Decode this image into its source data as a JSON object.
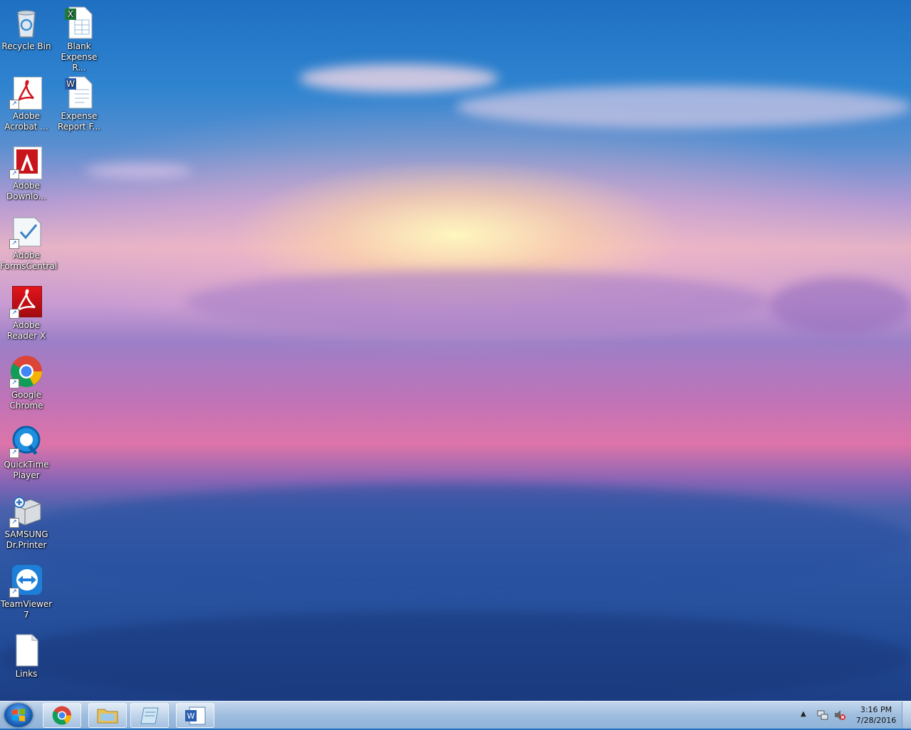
{
  "desktop": {
    "icons": [
      {
        "label": "Recycle Bin",
        "icon": "recycle-bin-icon"
      },
      {
        "label": "Blank Expense R...",
        "icon": "excel-file-icon"
      },
      {
        "label": "Adobe Acrobat ...",
        "icon": "adobe-acrobat-icon"
      },
      {
        "label": "Expense Report F...",
        "icon": "word-document-icon"
      },
      {
        "label": "Adobe Downlo...",
        "icon": "adobe-download-icon"
      },
      {
        "label": "Adobe FormsCentral",
        "icon": "adobe-formscentral-icon"
      },
      {
        "label": "Adobe Reader X",
        "icon": "adobe-reader-icon"
      },
      {
        "label": "Google Chrome",
        "icon": "google-chrome-icon"
      },
      {
        "label": "QuickTime Player",
        "icon": "quicktime-icon"
      },
      {
        "label": "SAMSUNG Dr.Printer",
        "icon": "samsung-printer-icon"
      },
      {
        "label": "TeamViewer 7",
        "icon": "teamviewer-icon"
      },
      {
        "label": "Links",
        "icon": "text-file-icon"
      }
    ]
  },
  "taskbar": {
    "start_icon": "windows-start-icon",
    "pinned": [
      {
        "icon": "google-chrome-icon"
      },
      {
        "icon": "file-explorer-icon"
      },
      {
        "icon": "notepad-icon"
      },
      {
        "icon": "microsoft-word-icon"
      }
    ],
    "clock": {
      "time": "3:16 PM",
      "date": "7/28/2016"
    }
  }
}
